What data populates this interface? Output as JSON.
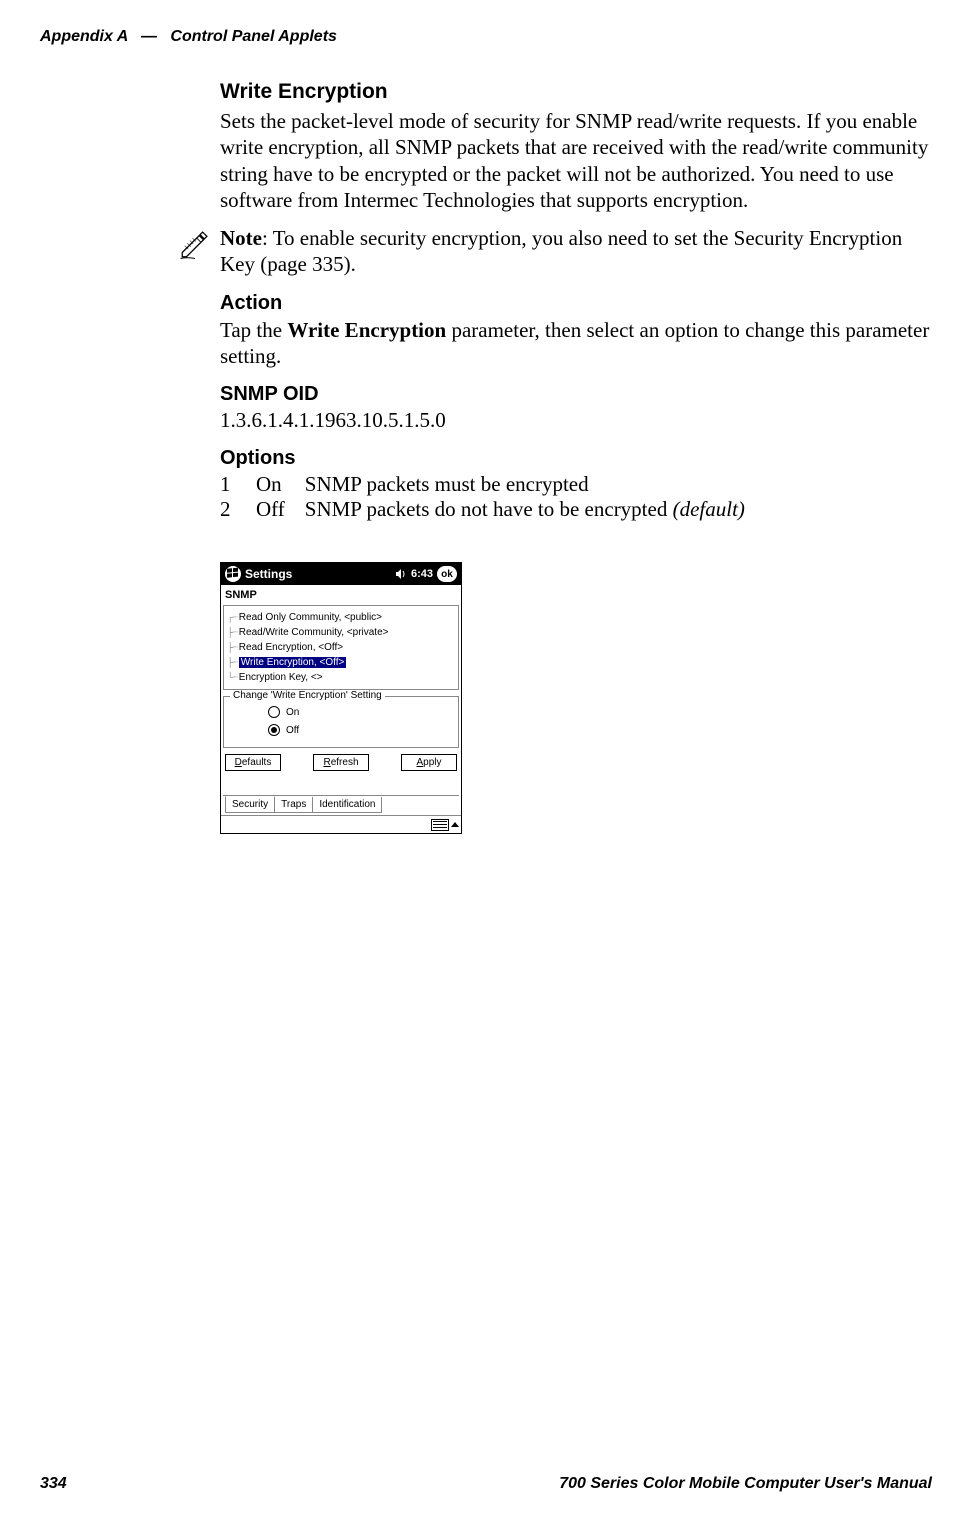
{
  "header": {
    "appendix": "Appendix  A",
    "dash": "—",
    "chapter": "Control Panel Applets"
  },
  "section": {
    "title": "Write Encryption",
    "description": "Sets the packet-level mode of security for SNMP read/write requests. If you enable write encryption, all SNMP packets that are received with the read/write community string have to be encrypted or the packet will not be authorized. You need to use software from Intermec Technologies that supports encryption."
  },
  "note": {
    "label": "Note",
    "text": ": To enable security encryption, you also need to set the Security Encryption Key (page 335)."
  },
  "action": {
    "heading": "Action",
    "prefix": "Tap the ",
    "bold": "Write Encryption",
    "suffix": " parameter, then select an option to change this parameter setting."
  },
  "snmp_oid": {
    "heading": "SNMP OID",
    "value": "1.3.6.1.4.1.1963.10.5.1.5.0"
  },
  "options": {
    "heading": "Options",
    "rows": [
      {
        "num": "1",
        "name": "On",
        "desc": "SNMP packets must be encrypted",
        "suffix": ""
      },
      {
        "num": "2",
        "name": "Off",
        "desc": "SNMP packets do not have to be encrypted ",
        "suffix": "(default)"
      }
    ]
  },
  "pda": {
    "title": "Settings",
    "time": "6:43",
    "ok": "ok",
    "app_name": "SNMP",
    "tree": [
      {
        "label": "Read Only Community, <public>",
        "selected": false
      },
      {
        "label": "Read/Write Community, <private>",
        "selected": false
      },
      {
        "label": "Read Encryption, <Off>",
        "selected": false
      },
      {
        "label": "Write Encryption, <Off>",
        "selected": true
      },
      {
        "label": "Encryption Key, <>",
        "selected": false
      }
    ],
    "groupbox_legend": "Change 'Write Encryption' Setting",
    "radio_on": "On",
    "radio_off": "Off",
    "buttons": {
      "defaults_u": "D",
      "defaults_rest": "efaults",
      "refresh_u": "R",
      "refresh_rest": "efresh",
      "apply_u": "A",
      "apply_rest": "pply"
    },
    "tabs": {
      "security": "Security",
      "traps": "Traps",
      "identification": "Identification"
    }
  },
  "footer": {
    "page": "334",
    "manual": "700 Series Color Mobile Computer User's Manual"
  }
}
